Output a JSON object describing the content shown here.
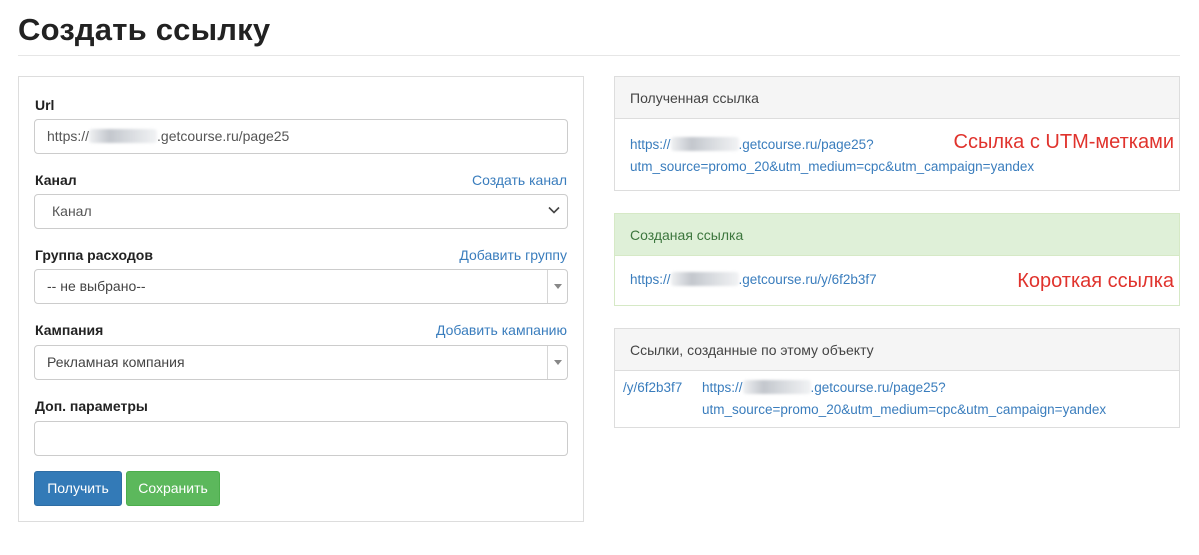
{
  "page": {
    "title": "Создать ссылку"
  },
  "form": {
    "url": {
      "label": "Url",
      "value_prefix": "https://",
      "value_blur_icon": "redacted-text-blur",
      "value_suffix": ".getcourse.ru/page25"
    },
    "channel": {
      "label": "Канал",
      "link": "Создать канал",
      "selected": "Канал"
    },
    "expense_group": {
      "label": "Группа расходов",
      "link": "Добавить группу",
      "selected": "-- не выбрано--"
    },
    "campaign": {
      "label": "Кампания",
      "link": "Добавить кампанию",
      "selected": "Рекламная компания"
    },
    "extra_params": {
      "label": "Доп. параметры",
      "value": ""
    },
    "get_button": "Получить",
    "save_button": "Сохранить"
  },
  "received_link": {
    "heading": "Полученная ссылка",
    "line1_prefix": "https://",
    "line1_suffix": ".getcourse.ru/page25?",
    "line2": "utm_source=promo_20&utm_medium=cpc&utm_campaign=yandex",
    "annotation": "Ссылка с UTM-метками"
  },
  "created_link": {
    "heading": "Созданая ссылка",
    "prefix": "https://",
    "suffix": ".getcourse.ru/y/6f2b3f7",
    "annotation": "Короткая ссылка"
  },
  "object_links": {
    "heading": "Ссылки, созданные по этому объекту",
    "rows": [
      {
        "short": "/y/6f2b3f7",
        "long_prefix": "https://",
        "long_suffix": ".getcourse.ru/page25?",
        "long_line2": "utm_source=promo_20&utm_medium=cpc&utm_campaign=yandex"
      }
    ]
  },
  "colors": {
    "link": "#3a7dbd",
    "annotation": "#e0332d",
    "primary": "#337ab7",
    "success": "#5cb85c",
    "success_heading_bg": "#dff0d8"
  }
}
